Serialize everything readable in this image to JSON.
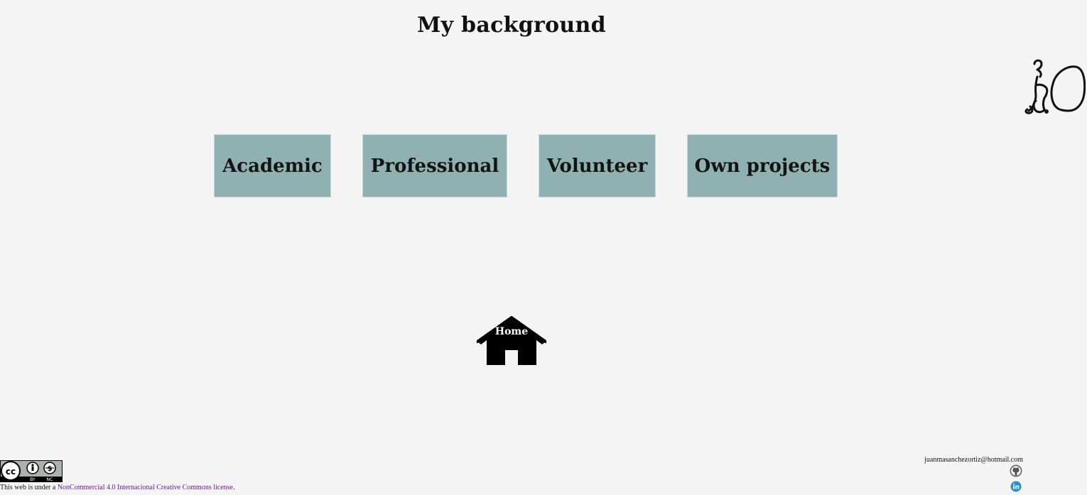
{
  "page": {
    "title": "My background"
  },
  "nav": {
    "items": [
      {
        "label": "Academic"
      },
      {
        "label": "Professional"
      },
      {
        "label": "Volunteer"
      },
      {
        "label": "Own projects"
      }
    ]
  },
  "home": {
    "label": "Home",
    "icon": "home-icon"
  },
  "logo": {
    "icon": "signature-logo"
  },
  "footer": {
    "license_prefix": "This web is under a ",
    "license_link": "NonCommercial 4.0 Internacional Creative Commons license",
    "license_suffix": ".",
    "email": "juanmasanchezortiz@hotmail.com",
    "cc_badge_labels": [
      "BY",
      "NC"
    ],
    "github_icon": "github-icon",
    "linkedin_icon": "linkedin-icon"
  },
  "colors": {
    "background": "#f4f4f4",
    "nav_box": "#8fb1b1",
    "link": "#5a1d8c",
    "linkedin": "#2a8fc9"
  }
}
